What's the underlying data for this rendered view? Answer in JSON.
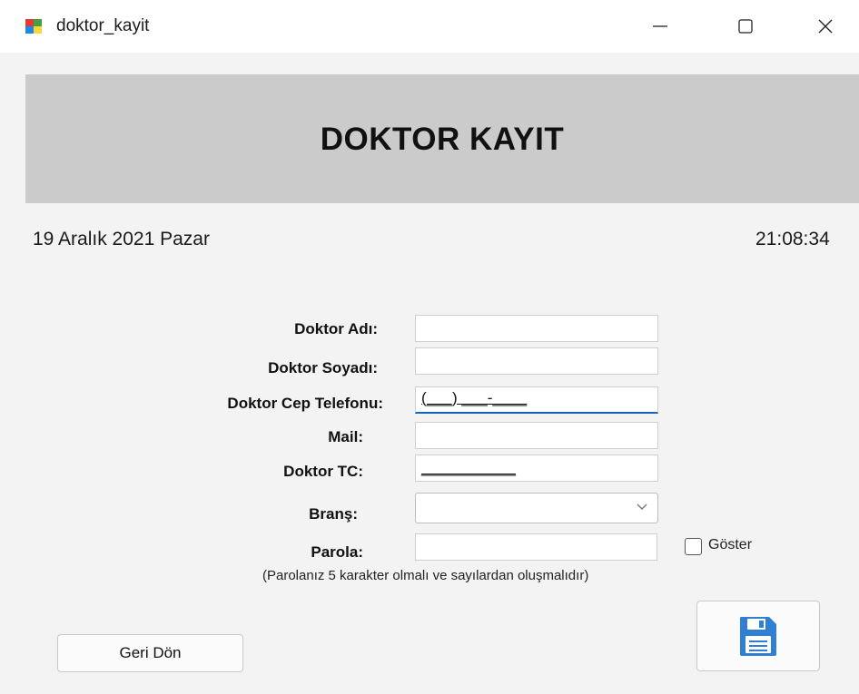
{
  "window": {
    "title": "doktor_kayit",
    "controls": {
      "minimize": "minimize-icon",
      "maximize": "maximize-icon",
      "close": "close-icon"
    }
  },
  "header": {
    "title": "DOKTOR KAYIT",
    "background": "#cbcbcb"
  },
  "status": {
    "date": "19 Aralık 2021 Pazar",
    "time": "21:08:34"
  },
  "form": {
    "first_name": {
      "label": "Doktor Adı:",
      "value": ""
    },
    "last_name": {
      "label": "Doktor Soyadı:",
      "value": ""
    },
    "phone": {
      "label": "Doktor Cep Telefonu:",
      "mask": "(___) ___-____"
    },
    "mail": {
      "label": "Mail:",
      "value": ""
    },
    "tc": {
      "label": "Doktor TC:",
      "mask": "___________"
    },
    "branch": {
      "label": "Branş:",
      "selected": ""
    },
    "password": {
      "label": "Parola:",
      "value": "",
      "show_label": "Göster",
      "show_checked": false
    },
    "hint": "(Parolanız 5 karakter olmalı ve sayılardan oluşmalıdır)"
  },
  "buttons": {
    "back_label": "Geri Dön",
    "save_icon": "floppy-disk-icon",
    "save_color": "#2f7fd3"
  }
}
